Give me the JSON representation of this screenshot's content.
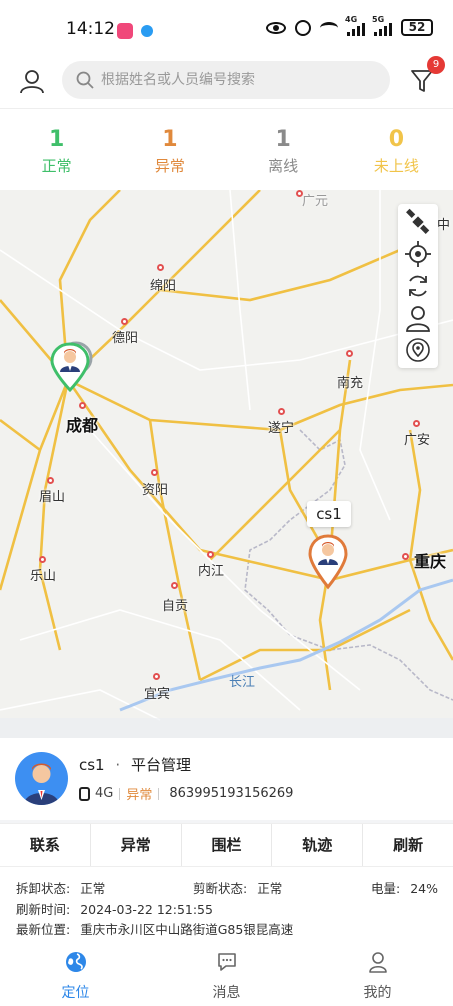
{
  "status_bar": {
    "time": "14:12",
    "network_1": "4G",
    "network_2": "5G",
    "battery": "52"
  },
  "header": {
    "search_placeholder": "根据姓名或人员编号搜索",
    "filter_badge": "9"
  },
  "stats": [
    {
      "count": "1",
      "label": "正常",
      "color": "#3fbf6a"
    },
    {
      "count": "1",
      "label": "异常",
      "color": "#e0893c"
    },
    {
      "count": "1",
      "label": "离线",
      "color": "#8a8a8a"
    },
    {
      "count": "0",
      "label": "未上线",
      "color": "#f1c44a"
    }
  ],
  "map": {
    "cities": [
      {
        "name": "广元"
      },
      {
        "name": "绵阳"
      },
      {
        "name": "德阳"
      },
      {
        "name": "成都"
      },
      {
        "name": "南充"
      },
      {
        "name": "遂宁"
      },
      {
        "name": "广安"
      },
      {
        "name": "资阳"
      },
      {
        "name": "眉山"
      },
      {
        "name": "乐山"
      },
      {
        "name": "内江"
      },
      {
        "name": "自贡"
      },
      {
        "name": "宜宾"
      },
      {
        "name": "重庆"
      },
      {
        "name": "中"
      }
    ],
    "river": "长江",
    "marker_label": "cs1",
    "tools": [
      "satellite-icon",
      "locate-icon",
      "refresh-icon",
      "person-icon",
      "location-history-icon"
    ]
  },
  "device": {
    "name": "cs1",
    "separator": "·",
    "group": "平台管理",
    "network": "4G",
    "status": "异常",
    "imei": "863995193156269"
  },
  "actions": [
    "联系",
    "异常",
    "围栏",
    "轨迹",
    "刷新"
  ],
  "info": {
    "detach_label": "拆卸状态:",
    "detach_value": "正常",
    "cut_label": "剪断状态:",
    "cut_value": "正常",
    "battery_label": "电量:",
    "battery_value": "24%",
    "refresh_label": "刷新时间:",
    "refresh_value": "2024-03-22 12:51:55",
    "location_label": "最新位置:",
    "location_value": "重庆市永川区中山路街道G85银昆高速"
  },
  "nav": [
    {
      "label": "定位",
      "icon": "globe-icon",
      "active": true
    },
    {
      "label": "消息",
      "icon": "message-icon",
      "active": false
    },
    {
      "label": "我的",
      "icon": "profile-icon",
      "active": false
    }
  ]
}
